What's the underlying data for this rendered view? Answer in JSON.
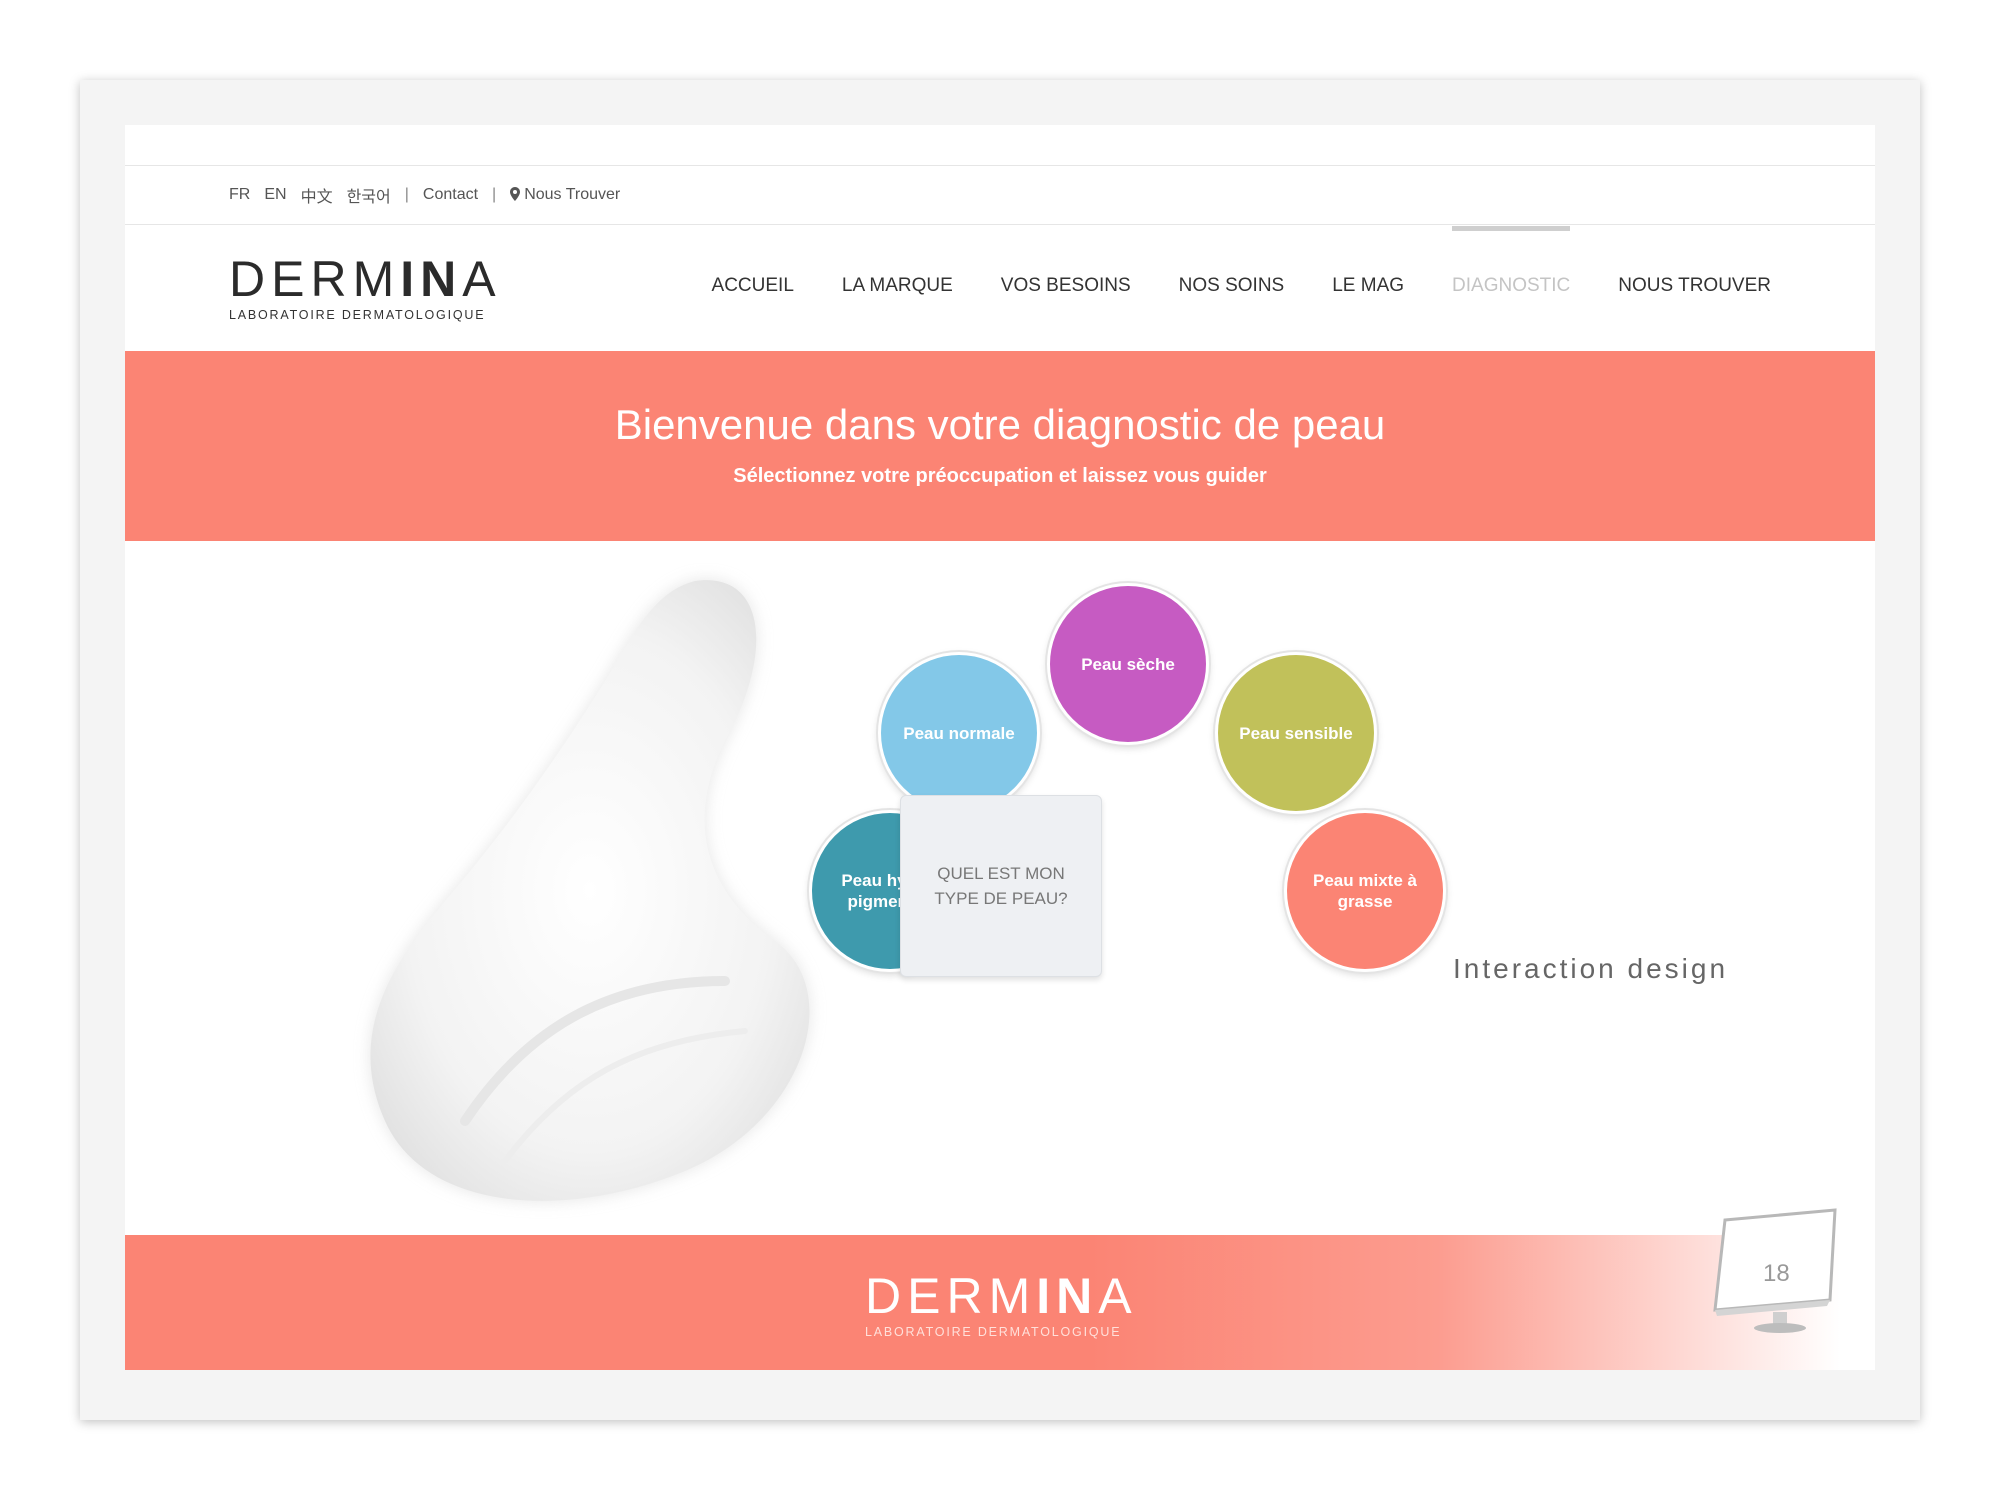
{
  "utility_bar": {
    "languages": [
      "FR",
      "EN",
      "中文",
      "한국어"
    ],
    "separator": "|",
    "contact": "Contact",
    "find_us": "Nous Trouver"
  },
  "logo": {
    "word_a": "DERM",
    "word_b": "IN",
    "word_c": "A",
    "subtitle": "LABORATOIRE DERMATOLOGIQUE"
  },
  "nav": {
    "items": [
      {
        "label": "ACCUEIL"
      },
      {
        "label": "LA MARQUE"
      },
      {
        "label": "VOS BESOINS"
      },
      {
        "label": "NOS SOINS"
      },
      {
        "label": "LE MAG"
      },
      {
        "label": "DIAGNOSTIC",
        "active": true
      },
      {
        "label": "NOUS TROUVER"
      }
    ]
  },
  "hero": {
    "title": "Bienvenue dans votre diagnostic de peau",
    "subtitle": "Sélectionnez votre préoccupation et laissez vous guider"
  },
  "diagnostic": {
    "center_question": "QUEL EST MON TYPE DE PEAU?",
    "bubbles": [
      {
        "label": "Peau sèche",
        "color": "#c65bc2"
      },
      {
        "label": "Peau normale",
        "color": "#83c8e8"
      },
      {
        "label": "Peau sensible",
        "color": "#c1c15a"
      },
      {
        "label": "Peau hyper-pigmentée",
        "color": "#3e9aad"
      },
      {
        "label": "Peau mixte à grasse",
        "color": "#fb8474"
      }
    ]
  },
  "caption": "Interaction design",
  "footer": {
    "word_a": "DERM",
    "word_b": "IN",
    "word_c": "A",
    "subtitle": "LABORATOIRE DERMATOLOGIQUE",
    "page_number": "18"
  },
  "colors": {
    "accent": "#fb8474",
    "text": "#333333"
  }
}
